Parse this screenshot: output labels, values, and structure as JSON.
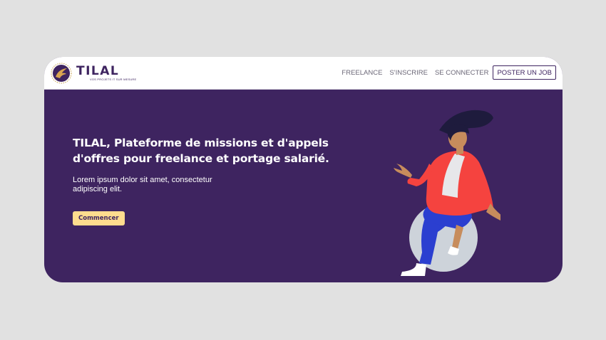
{
  "brand": {
    "name": "TILAL",
    "tagline": "VOS PROJETS IT SUR MESURE"
  },
  "nav": {
    "links": [
      "FREELANCE",
      "S'INSCRIRE",
      "SE CONNECTER"
    ],
    "cta_label": "POSTER UN JOB"
  },
  "hero": {
    "title": "TILAL, Plateforme de missions et d'appels d'offres pour freelance et portage salarié.",
    "text": "Lorem ipsum dolor sit amet, consectetur adipiscing elit.",
    "cta_label": "Commencer"
  },
  "icons": {
    "logo": "eagle-emblem-icon",
    "illustration": "woman-on-exercise-ball"
  },
  "colors": {
    "brand_purple": "#3e2460",
    "cta_yellow": "#fedc8e",
    "page_bg": "#e1e1e1",
    "jacket": "#f5433f",
    "pants": "#2b3fd0"
  }
}
